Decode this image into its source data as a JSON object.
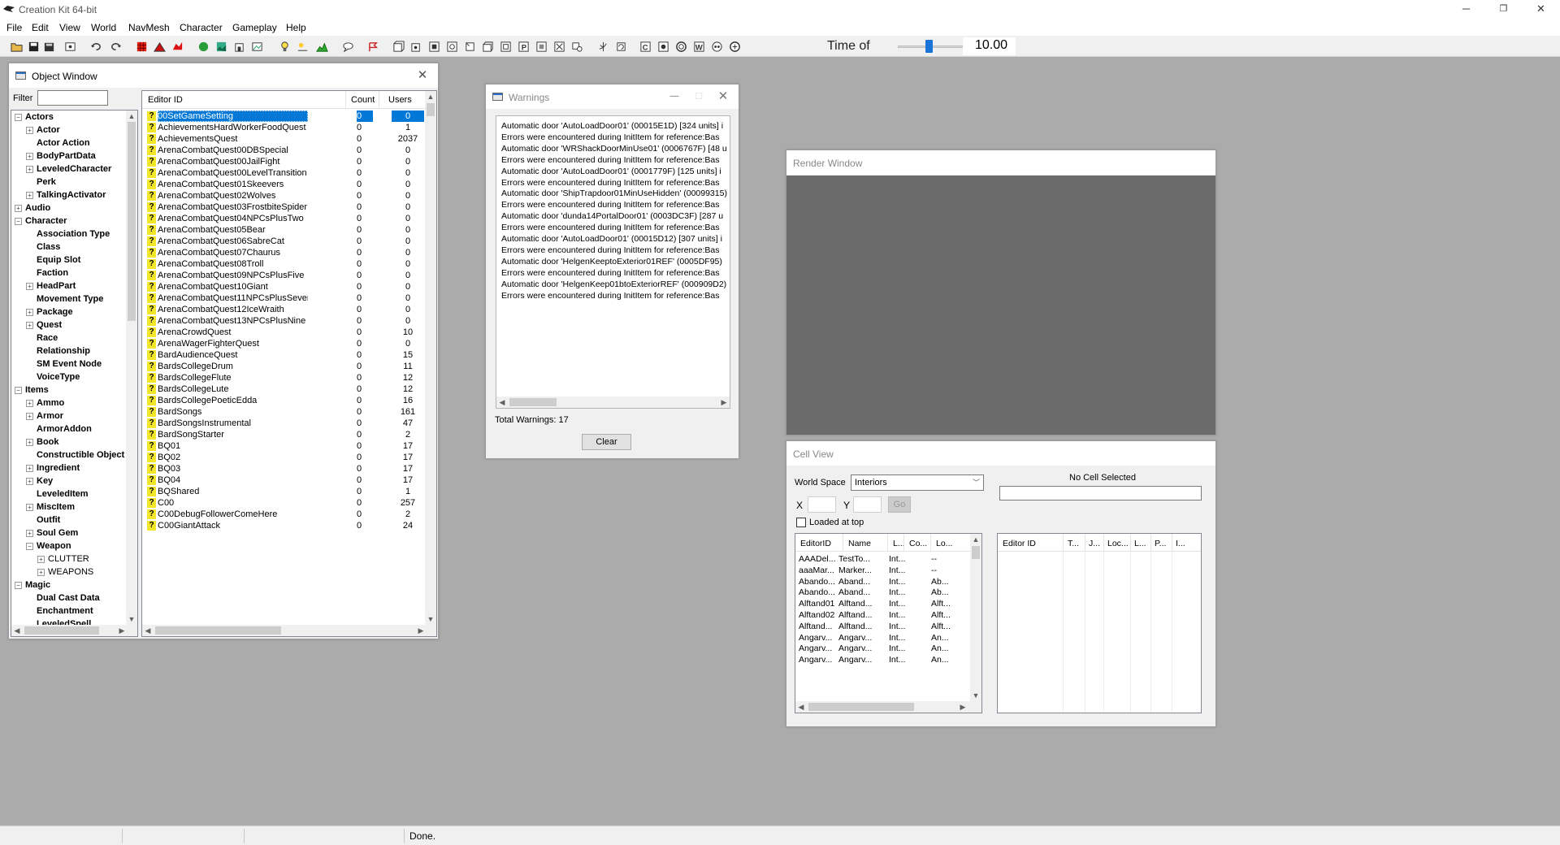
{
  "app": {
    "title": "Creation Kit 64-bit",
    "window_controls": {
      "minimize": "─",
      "restore": "❐",
      "close": "✕"
    }
  },
  "menu": [
    "File",
    "Edit",
    "View",
    "World",
    "NavMesh",
    "Character",
    "Gameplay",
    "Help"
  ],
  "toolbar": {
    "icons": [
      "open-file-icon",
      "save-icon",
      "save-as-icon",
      "preferences-icon",
      "undo-icon",
      "redo-icon",
      "red-grid-icon",
      "red-terrain-icon",
      "red-flag-icon",
      "green-sphere-icon",
      "landscape-icon",
      "building-icon",
      "picture-icon",
      "lightbulb-icon",
      "sky-icon",
      "terrain-edit-icon",
      "speech-bubble-icon",
      "navmesh-icon",
      "box1-icon",
      "box2-icon",
      "box3-icon",
      "box4-icon",
      "box5-icon",
      "box6-icon",
      "box7-icon",
      "box8-icon",
      "box9-icon",
      "box10-icon",
      "box11-icon",
      "tree-icon",
      "rotate-icon",
      "c-icon",
      "cam-icon",
      "sphere-icon",
      "w-icon",
      "eye-icon",
      "fx-icon"
    ],
    "time_label": "Time of",
    "time_value": "10.00",
    "time_fraction": 0.42
  },
  "object_window": {
    "title": "Object Window",
    "filter_label": "Filter",
    "filter_value": "",
    "tree": [
      {
        "label": "Actors",
        "level": 0,
        "expand": "-"
      },
      {
        "label": "Actor",
        "level": 1,
        "expand": "+"
      },
      {
        "label": "Actor Action",
        "level": 1,
        "expand": ""
      },
      {
        "label": "BodyPartData",
        "level": 1,
        "expand": "+"
      },
      {
        "label": "LeveledCharacter",
        "level": 1,
        "expand": "+"
      },
      {
        "label": "Perk",
        "level": 1,
        "expand": ""
      },
      {
        "label": "TalkingActivator",
        "level": 1,
        "expand": "+"
      },
      {
        "label": "Audio",
        "level": 0,
        "expand": "+"
      },
      {
        "label": "Character",
        "level": 0,
        "expand": "-"
      },
      {
        "label": "Association Type",
        "level": 1,
        "expand": ""
      },
      {
        "label": "Class",
        "level": 1,
        "expand": ""
      },
      {
        "label": "Equip Slot",
        "level": 1,
        "expand": ""
      },
      {
        "label": "Faction",
        "level": 1,
        "expand": ""
      },
      {
        "label": "HeadPart",
        "level": 1,
        "expand": "+"
      },
      {
        "label": "Movement Type",
        "level": 1,
        "expand": ""
      },
      {
        "label": "Package",
        "level": 1,
        "expand": "+"
      },
      {
        "label": "Quest",
        "level": 1,
        "expand": "+"
      },
      {
        "label": "Race",
        "level": 1,
        "expand": ""
      },
      {
        "label": "Relationship",
        "level": 1,
        "expand": ""
      },
      {
        "label": "SM Event Node",
        "level": 1,
        "expand": ""
      },
      {
        "label": "VoiceType",
        "level": 1,
        "expand": ""
      },
      {
        "label": "Items",
        "level": 0,
        "expand": "-"
      },
      {
        "label": "Ammo",
        "level": 1,
        "expand": "+"
      },
      {
        "label": "Armor",
        "level": 1,
        "expand": "+"
      },
      {
        "label": "ArmorAddon",
        "level": 1,
        "expand": ""
      },
      {
        "label": "Book",
        "level": 1,
        "expand": "+"
      },
      {
        "label": "Constructible Object",
        "level": 1,
        "expand": ""
      },
      {
        "label": "Ingredient",
        "level": 1,
        "expand": "+"
      },
      {
        "label": "Key",
        "level": 1,
        "expand": "+"
      },
      {
        "label": "LeveledItem",
        "level": 1,
        "expand": ""
      },
      {
        "label": "MiscItem",
        "level": 1,
        "expand": "+"
      },
      {
        "label": "Outfit",
        "level": 1,
        "expand": ""
      },
      {
        "label": "Soul Gem",
        "level": 1,
        "expand": "+"
      },
      {
        "label": "Weapon",
        "level": 1,
        "expand": "-"
      },
      {
        "label": "CLUTTER",
        "level": 2,
        "expand": "+"
      },
      {
        "label": "WEAPONS",
        "level": 2,
        "expand": "+"
      },
      {
        "label": "Magic",
        "level": 0,
        "expand": "-"
      },
      {
        "label": "Dual Cast Data",
        "level": 1,
        "expand": ""
      },
      {
        "label": "Enchantment",
        "level": 1,
        "expand": ""
      },
      {
        "label": "LeveledSpell",
        "level": 1,
        "expand": ""
      }
    ],
    "columns": [
      "Editor ID",
      "Count",
      "Users"
    ],
    "rows": [
      {
        "id": "00SetGameSetting",
        "count": "0",
        "users": "0",
        "selected": true
      },
      {
        "id": "AchievementsHardWorkerFoodQuest",
        "count": "0",
        "users": "1"
      },
      {
        "id": "AchievementsQuest",
        "count": "0",
        "users": "2037"
      },
      {
        "id": "ArenaCombatQuest00DBSpecial",
        "count": "0",
        "users": "0"
      },
      {
        "id": "ArenaCombatQuest00JailFight",
        "count": "0",
        "users": "0"
      },
      {
        "id": "ArenaCombatQuest00LevelTransition",
        "count": "0",
        "users": "0"
      },
      {
        "id": "ArenaCombatQuest01Skeevers",
        "count": "0",
        "users": "0"
      },
      {
        "id": "ArenaCombatQuest02Wolves",
        "count": "0",
        "users": "0"
      },
      {
        "id": "ArenaCombatQuest03FrostbiteSpider",
        "count": "0",
        "users": "0"
      },
      {
        "id": "ArenaCombatQuest04NPCsPlusTwo",
        "count": "0",
        "users": "0"
      },
      {
        "id": "ArenaCombatQuest05Bear",
        "count": "0",
        "users": "0"
      },
      {
        "id": "ArenaCombatQuest06SabreCat",
        "count": "0",
        "users": "0"
      },
      {
        "id": "ArenaCombatQuest07Chaurus",
        "count": "0",
        "users": "0"
      },
      {
        "id": "ArenaCombatQuest08Troll",
        "count": "0",
        "users": "0"
      },
      {
        "id": "ArenaCombatQuest09NPCsPlusFive",
        "count": "0",
        "users": "0"
      },
      {
        "id": "ArenaCombatQuest10Giant",
        "count": "0",
        "users": "0"
      },
      {
        "id": "ArenaCombatQuest11NPCsPlusSeven",
        "count": "0",
        "users": "0"
      },
      {
        "id": "ArenaCombatQuest12IceWraith",
        "count": "0",
        "users": "0"
      },
      {
        "id": "ArenaCombatQuest13NPCsPlusNine",
        "count": "0",
        "users": "0"
      },
      {
        "id": "ArenaCrowdQuest",
        "count": "0",
        "users": "10"
      },
      {
        "id": "ArenaWagerFighterQuest",
        "count": "0",
        "users": "0"
      },
      {
        "id": "BardAudienceQuest",
        "count": "0",
        "users": "15"
      },
      {
        "id": "BardsCollegeDrum",
        "count": "0",
        "users": "11"
      },
      {
        "id": "BardsCollegeFlute",
        "count": "0",
        "users": "12"
      },
      {
        "id": "BardsCollegeLute",
        "count": "0",
        "users": "12"
      },
      {
        "id": "BardsCollegePoeticEdda",
        "count": "0",
        "users": "16"
      },
      {
        "id": "BardSongs",
        "count": "0",
        "users": "161"
      },
      {
        "id": "BardSongsInstrumental",
        "count": "0",
        "users": "47"
      },
      {
        "id": "BardSongStarter",
        "count": "0",
        "users": "2"
      },
      {
        "id": "BQ01",
        "count": "0",
        "users": "17"
      },
      {
        "id": "BQ02",
        "count": "0",
        "users": "17"
      },
      {
        "id": "BQ03",
        "count": "0",
        "users": "17"
      },
      {
        "id": "BQ04",
        "count": "0",
        "users": "17"
      },
      {
        "id": "BQShared",
        "count": "0",
        "users": "1"
      },
      {
        "id": "C00",
        "count": "0",
        "users": "257"
      },
      {
        "id": "C00DebugFollowerComeHere",
        "count": "0",
        "users": "2"
      },
      {
        "id": "C00GiantAttack",
        "count": "0",
        "users": "24"
      }
    ]
  },
  "warnings": {
    "title": "Warnings",
    "lines": [
      "Automatic door 'AutoLoadDoor01' (00015E1D) [324 units] i",
      "Errors were encountered during InitItem for reference:Bas",
      "Automatic door 'WRShackDoorMinUse01' (0006767F) [48 u",
      "Errors were encountered during InitItem for reference:Bas",
      "Automatic door 'AutoLoadDoor01' (0001779F) [125 units] i",
      "Errors were encountered during InitItem for reference:Bas",
      "Automatic door 'ShipTrapdoor01MinUseHidden' (00099315)",
      "Errors were encountered during InitItem for reference:Bas",
      "Automatic door 'dunda14PortalDoor01' (0003DC3F) [287 u",
      "Errors were encountered during InitItem for reference:Bas",
      "Automatic door 'AutoLoadDoor01' (00015D12) [307 units] i",
      "Errors were encountered during InitItem for reference:Bas",
      "Automatic door 'HelgenKeeptoExterior01REF' (0005DF95)",
      "Errors were encountered during InitItem for reference:Bas",
      "Automatic door 'HelgenKeep01btoExteriorREF' (000909D2)",
      "Errors were encountered during InitItem for reference:Bas"
    ],
    "total": "Total Warnings: 17",
    "clear_label": "Clear"
  },
  "render_window": {
    "title": "Render Window"
  },
  "cell_view": {
    "title": "Cell View",
    "world_space_label": "World Space",
    "world_space_value": "Interiors",
    "no_cell": "No Cell Selected",
    "x_label": "X",
    "y_label": "Y",
    "go_label": "Go",
    "loaded_at_top": "Loaded at top",
    "left_columns": [
      "EditorID",
      "Name",
      "L...",
      "Co...",
      "Lo..."
    ],
    "left_rows": [
      [
        "AAADel...",
        "TestTo...",
        "",
        "Int...",
        "--"
      ],
      [
        "aaaMar...",
        "Marker...",
        "",
        "Int...",
        "--"
      ],
      [
        "Abando...",
        "Aband...",
        "",
        "Int...",
        "Ab..."
      ],
      [
        "Abando...",
        "Aband...",
        "",
        "Int...",
        "Ab..."
      ],
      [
        "Alftand01",
        "Alftand...",
        "",
        "Int...",
        "Alft..."
      ],
      [
        "Alftand02",
        "Alftand...",
        "",
        "Int...",
        "Alft..."
      ],
      [
        "Alftand...",
        "Alftand...",
        "",
        "Int...",
        "Alft..."
      ],
      [
        "Angarv...",
        "Angarv...",
        "",
        "Int...",
        "An..."
      ],
      [
        "Angarv...",
        "Angarv...",
        "",
        "Int...",
        "An..."
      ],
      [
        "Angarv...",
        "Angarv...",
        "",
        "Int...",
        "An..."
      ]
    ],
    "right_columns": [
      "Editor ID",
      "T...",
      "J...",
      "Loc...",
      "L...",
      "P...",
      "I..."
    ]
  },
  "status": {
    "text": "Done."
  }
}
